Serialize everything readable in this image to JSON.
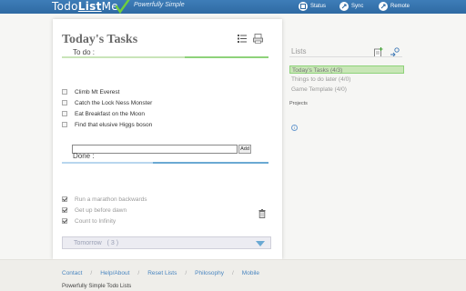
{
  "header": {
    "logo_todo": "Todo",
    "logo_list": "List",
    "logo_me": "Me",
    "tagline": "Powerfully Simple",
    "nav": [
      {
        "label": "Status",
        "icon": "status-icon"
      },
      {
        "label": "Sync",
        "icon": "sync-icon"
      },
      {
        "label": "Remote",
        "icon": "remote-icon"
      }
    ]
  },
  "panel": {
    "title": "Today's Tasks",
    "todo_label": "To do :",
    "todo_items": [
      "Climb Mt Everest",
      "Catch the Lock Ness Monster",
      "Eat Breakfast on the Moon",
      "Find that elusive Higgs boson"
    ],
    "add_input_value": "",
    "add_button": "Add",
    "done_label": "Done :",
    "done_items": [
      "Run a marathon backwards",
      "Get up before dawn",
      "Count to Infinity"
    ],
    "tomorrow_label": "Tomorrow",
    "tomorrow_count": "( 3 )"
  },
  "lists": {
    "title": "Lists",
    "items": [
      {
        "label": "Today's Tasks (4/3)",
        "active": true
      },
      {
        "label": "Things to do later (4/0)",
        "active": false
      },
      {
        "label": "Game Template (4/0)",
        "active": false
      }
    ],
    "projects_label": "Projects"
  },
  "footer": {
    "links": [
      "Contact",
      "Help/About",
      "Reset Lists",
      "Philosophy",
      "Mobile"
    ],
    "tagline": "Powerfully Simple Todo Lists"
  },
  "colors": {
    "header_blue": "#2f6aa3",
    "accent_green": "#8ed27a",
    "done_blue": "#6aa9d3",
    "link_blue": "#4a86c0"
  }
}
